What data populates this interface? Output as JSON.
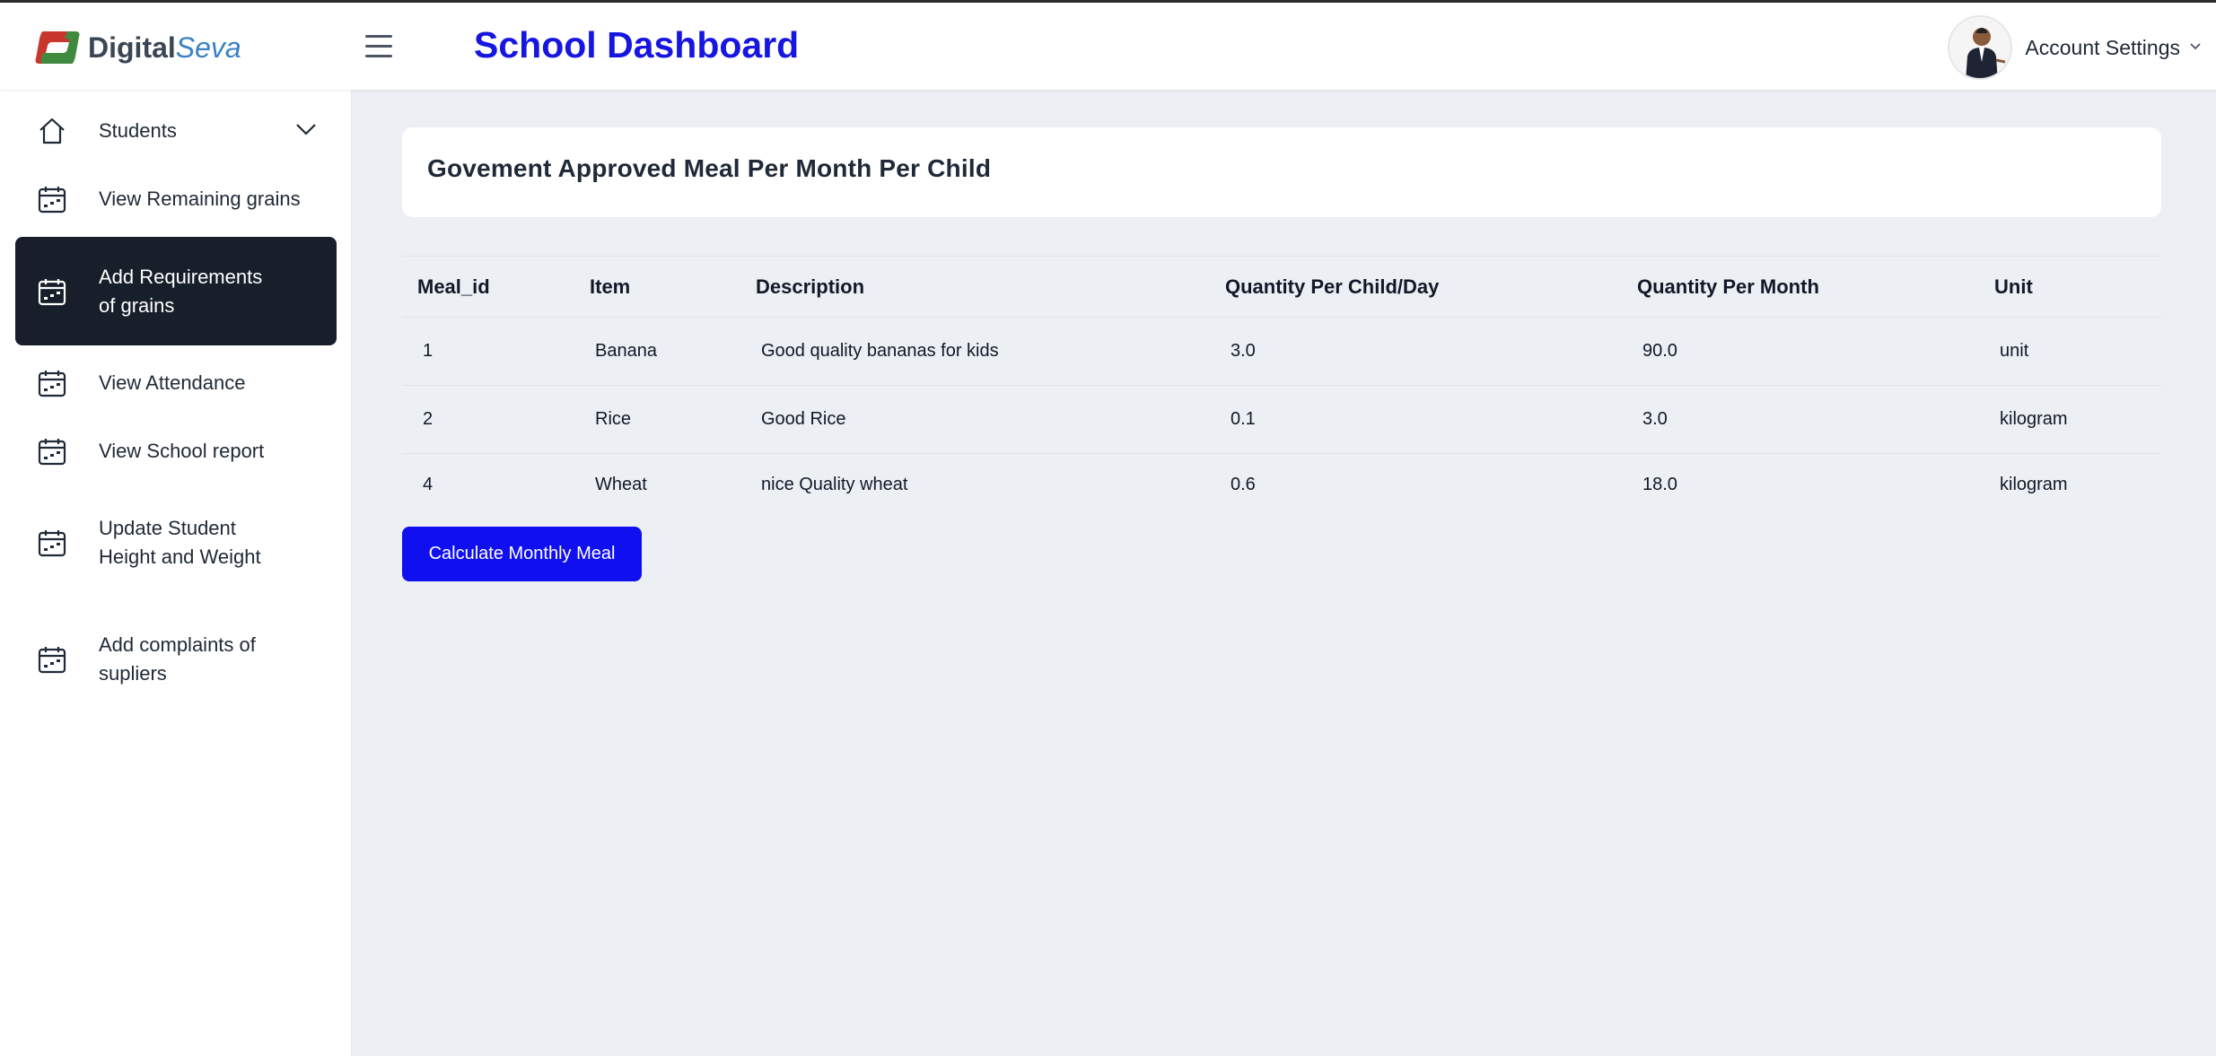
{
  "brand": {
    "name_part1": "Digital",
    "name_part2": "Seva"
  },
  "header": {
    "title": "School Dashboard",
    "account_label": "Account Settings"
  },
  "sidebar": {
    "items": [
      {
        "label": "Students",
        "icon": "home-icon"
      },
      {
        "label": "View Remaining grains",
        "icon": "calendar-icon"
      },
      {
        "label": "Add Requirements of grains",
        "icon": "calendar-icon",
        "active": true
      },
      {
        "label": "View Attendance",
        "icon": "calendar-icon"
      },
      {
        "label": "View School report",
        "icon": "calendar-icon"
      },
      {
        "label": "Update Student Height and Weight",
        "icon": "calendar-icon"
      },
      {
        "label": "Add complaints of supliers",
        "icon": "calendar-icon"
      }
    ]
  },
  "main": {
    "card_title": "Govement Approved Meal Per Month Per Child",
    "table": {
      "columns": [
        "Meal_id",
        "Item",
        "Description",
        "Quantity Per Child/Day",
        "Quantity Per Month",
        "Unit"
      ],
      "rows": [
        [
          "1",
          "Banana",
          "Good quality bananas for kids",
          "3.0",
          "90.0",
          "unit"
        ],
        [
          "2",
          "Rice",
          "Good Rice",
          "0.1",
          "3.0",
          "kilogram"
        ],
        [
          "4",
          "Wheat",
          "nice Quality wheat",
          "0.6",
          "18.0",
          "kilogram"
        ]
      ]
    },
    "button_label": "Calculate Monthly Meal"
  },
  "colors": {
    "accent": "#1616e0",
    "button": "#0f0ff0",
    "active_nav": "#17202a",
    "background": "#eceff4"
  }
}
